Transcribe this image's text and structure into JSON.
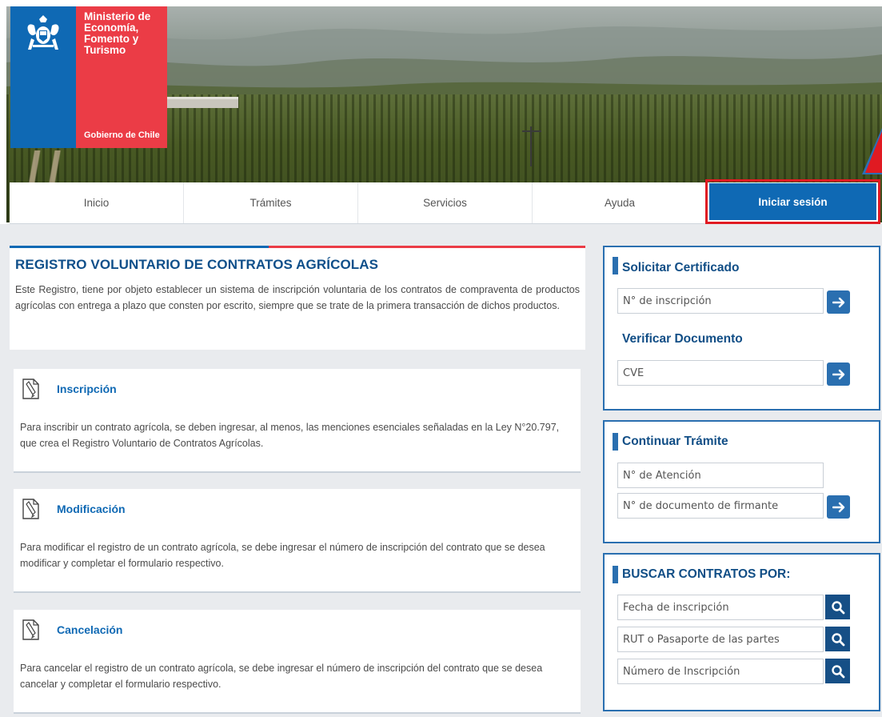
{
  "header": {
    "ministry_name": "Ministerio de Economía, Fomento y Turismo",
    "government": "Gobierno de Chile"
  },
  "nav": {
    "items": [
      {
        "label": "Inicio"
      },
      {
        "label": "Trámites"
      },
      {
        "label": "Servicios"
      },
      {
        "label": "Ayuda"
      }
    ],
    "login_label": "Iniciar sesión"
  },
  "intro": {
    "title": "REGISTRO VOLUNTARIO DE CONTRATOS AGRÍCOLAS",
    "text": "Este Registro, tiene por objeto establecer un sistema de inscripción voluntaria de los contratos de compraventa de productos agrícolas con entrega a plazo que consten por escrito, siempre que se trate de la primera transacción de dichos productos."
  },
  "cards": [
    {
      "title": "Inscripción",
      "text": "Para inscribir un contrato agrícola, se deben ingresar, al menos, las menciones esenciales señaladas en la Ley N°20.797, que crea el Registro Voluntario de Contratos Agrícolas."
    },
    {
      "title": "Modificación",
      "text": "Para modificar el registro de un contrato agrícola, se debe ingresar el número de inscripción del contrato que se desea modificar y completar el formulario respectivo."
    },
    {
      "title": "Cancelación",
      "text": "Para cancelar el registro de un contrato agrícola, se debe ingresar el número de inscripción del contrato que se desea cancelar y completar el formulario respectivo."
    }
  ],
  "sidebar": {
    "certificate": {
      "title": "Solicitar Certificado",
      "placeholder": "N° de inscripción",
      "verify_title": "Verificar Documento",
      "verify_placeholder": "CVE"
    },
    "continue": {
      "title": "Continuar Trámite",
      "attention_placeholder": "N° de Atención",
      "signer_placeholder": "N° de documento de firmante"
    },
    "search": {
      "title": "BUSCAR CONTRATOS POR:",
      "fields": [
        {
          "placeholder": "Fecha de inscripción"
        },
        {
          "placeholder": "RUT o Pasaporte de las partes"
        },
        {
          "placeholder": "Número de Inscripción"
        }
      ]
    }
  },
  "colors": {
    "brand_blue": "#0f69b4",
    "brand_red": "#eb3c46",
    "highlight_red": "#e01a22"
  },
  "icons": {
    "card_icon": "document-pen-icon",
    "go_icon": "arrow-right-icon",
    "search_icon": "magnifier-icon"
  }
}
